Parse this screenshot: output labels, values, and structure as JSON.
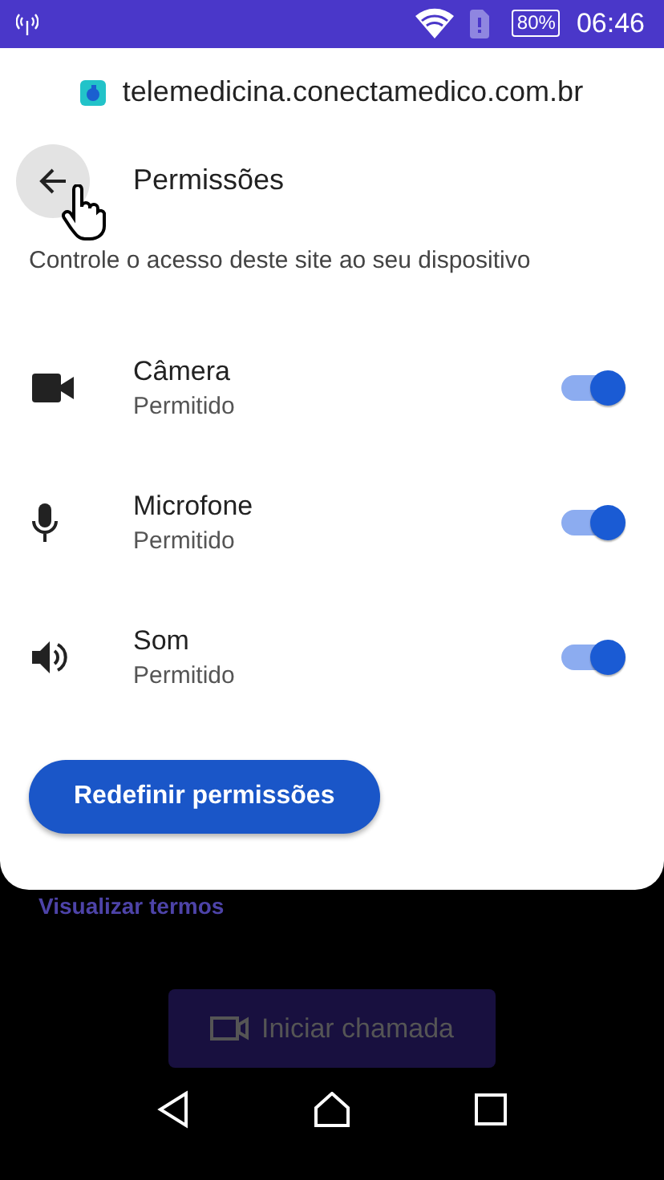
{
  "status_bar": {
    "battery": "80%",
    "time": "06:46"
  },
  "sheet": {
    "url": "telemedicina.conectamedico.com.br",
    "title": "Permissões",
    "description": "Controle o acesso deste site ao seu dispositivo",
    "permissions": [
      {
        "kind": "camera",
        "name": "Câmera",
        "status": "Permitido",
        "on": true
      },
      {
        "kind": "microphone",
        "name": "Microfone",
        "status": "Permitido",
        "on": true
      },
      {
        "kind": "sound",
        "name": "Som",
        "status": "Permitido",
        "on": true
      }
    ],
    "reset_button": "Redefinir permissões"
  },
  "background": {
    "link": "Visualizar termos",
    "call_button": "Iniciar chamada"
  }
}
